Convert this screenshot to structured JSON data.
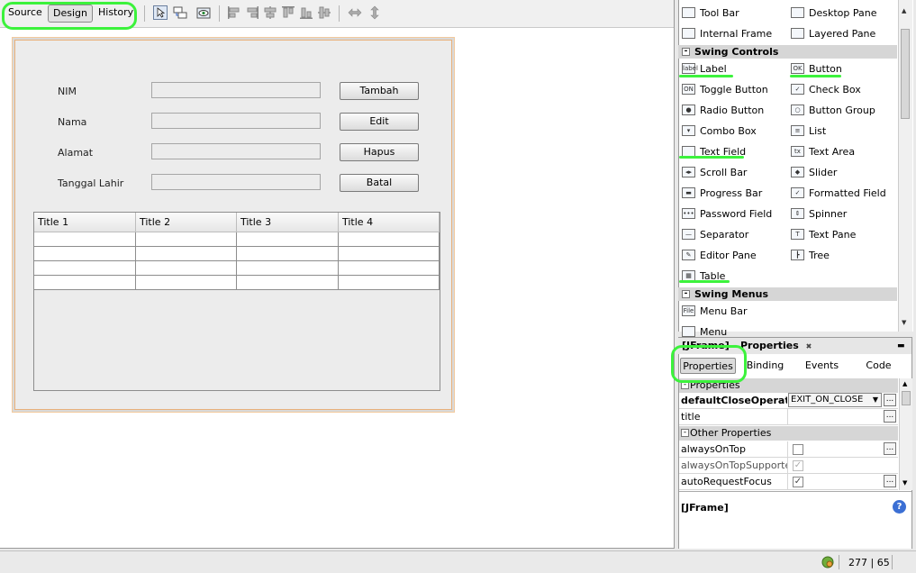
{
  "editor": {
    "tabs": [
      "Source",
      "Design",
      "History"
    ],
    "active_tab": "Design"
  },
  "form": {
    "labels": [
      "NIM",
      "Nama",
      "Alamat",
      "Tanggal Lahir"
    ],
    "buttons": [
      "Tambah",
      "Edit",
      "Hapus",
      "Batal"
    ],
    "table_headers": [
      "Title 1",
      "Title 2",
      "Title 3",
      "Title 4"
    ],
    "table_row_count": 4
  },
  "palette": {
    "top_items": [
      {
        "label": "Tool Bar",
        "icon": "toolbar-icon"
      },
      {
        "label": "Desktop Pane",
        "icon": "desktop-pane-icon"
      },
      {
        "label": "Internal Frame",
        "icon": "internal-frame-icon"
      },
      {
        "label": "Layered Pane",
        "icon": "layered-pane-icon"
      }
    ],
    "swing_controls_label": "Swing Controls",
    "swing_controls": [
      {
        "label": "Label",
        "icon": "label-icon",
        "glyph": "label"
      },
      {
        "label": "Button",
        "icon": "button-icon",
        "glyph": "OK"
      },
      {
        "label": "Toggle Button",
        "icon": "toggle-button-icon",
        "glyph": "ON"
      },
      {
        "label": "Check Box",
        "icon": "checkbox-icon",
        "glyph": "✓"
      },
      {
        "label": "Radio Button",
        "icon": "radio-button-icon",
        "glyph": "●"
      },
      {
        "label": "Button Group",
        "icon": "button-group-icon",
        "glyph": "○"
      },
      {
        "label": "Combo Box",
        "icon": "combo-box-icon",
        "glyph": "▾"
      },
      {
        "label": "List",
        "icon": "list-icon",
        "glyph": "≡"
      },
      {
        "label": "Text Field",
        "icon": "text-field-icon",
        "glyph": ""
      },
      {
        "label": "Text Area",
        "icon": "text-area-icon",
        "glyph": "tx"
      },
      {
        "label": "Scroll Bar",
        "icon": "scroll-bar-icon",
        "glyph": "◂▸"
      },
      {
        "label": "Slider",
        "icon": "slider-icon",
        "glyph": "◆"
      },
      {
        "label": "Progress Bar",
        "icon": "progress-bar-icon",
        "glyph": "▬"
      },
      {
        "label": "Formatted Field",
        "icon": "formatted-field-icon",
        "glyph": "✓"
      },
      {
        "label": "Password Field",
        "icon": "password-field-icon",
        "glyph": "•••"
      },
      {
        "label": "Spinner",
        "icon": "spinner-icon",
        "glyph": "⇕"
      },
      {
        "label": "Separator",
        "icon": "separator-icon",
        "glyph": "—"
      },
      {
        "label": "Text Pane",
        "icon": "text-pane-icon",
        "glyph": "T"
      },
      {
        "label": "Editor Pane",
        "icon": "editor-pane-icon",
        "glyph": "✎"
      },
      {
        "label": "Tree",
        "icon": "tree-icon",
        "glyph": "┣"
      },
      {
        "label": "Table",
        "icon": "table-icon",
        "glyph": "▦"
      }
    ],
    "swing_menus_label": "Swing Menus",
    "swing_menus": [
      {
        "label": "Menu Bar",
        "icon": "menu-bar-icon",
        "glyph": "File"
      },
      {
        "label": "Menu",
        "icon": "menu-icon",
        "glyph": ""
      }
    ]
  },
  "properties": {
    "title": "[JFrame] - Properties",
    "close_glyph": "✖",
    "minimize_glyph": "▬",
    "tabs": [
      "Properties",
      "Binding",
      "Events",
      "Code"
    ],
    "section_properties": "Properties",
    "section_other": "Other Properties",
    "rows_main": [
      {
        "name": "defaultCloseOperation",
        "value": "EXIT_ON_CLOSE",
        "bold": true,
        "type": "combo"
      },
      {
        "name": "title",
        "value": "",
        "bold": false,
        "type": "text"
      }
    ],
    "rows_other": [
      {
        "name": "alwaysOnTop",
        "checked": false,
        "disabled": false
      },
      {
        "name": "alwaysOnTopSupported",
        "checked": true,
        "disabled": true
      },
      {
        "name": "autoRequestFocus",
        "checked": true,
        "disabled": false
      }
    ],
    "ellipsis": "...",
    "description_title": "[JFrame]",
    "help_glyph": "?"
  },
  "status": {
    "position": "277 | 65"
  }
}
